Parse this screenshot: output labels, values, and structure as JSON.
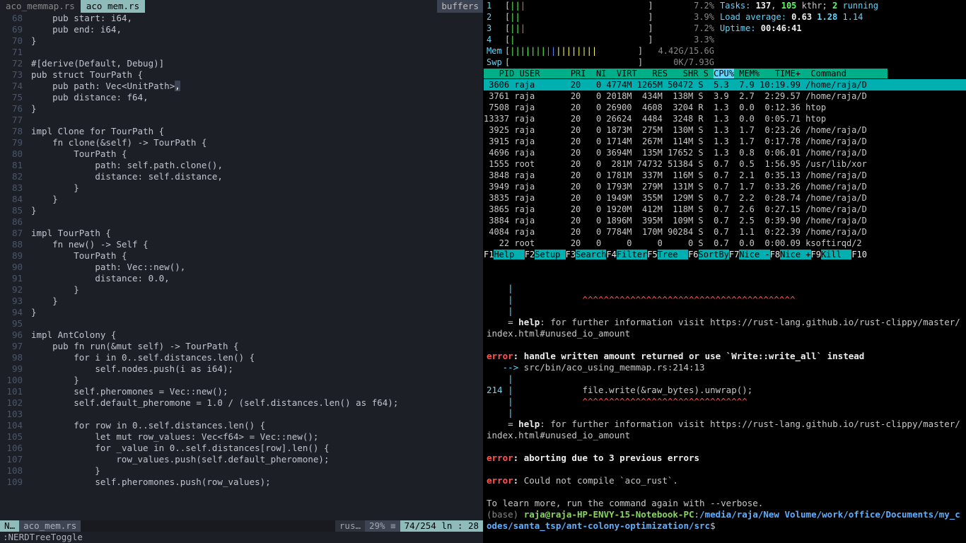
{
  "tabs": {
    "inactive": "aco_memmap.rs",
    "active": " aco mem.rs ",
    "buffers": "buffers"
  },
  "code": [
    {
      "n": 68,
      "h": "    <kw>pub</kw> <fld>start</fld>: <ty>i64</ty>,"
    },
    {
      "n": 69,
      "h": "    <kw>pub</kw> <fld>end</fld>: <ty>i64</ty>,"
    },
    {
      "n": 70,
      "h": "}"
    },
    {
      "n": 71,
      "h": ""
    },
    {
      "n": 72,
      "h": "<attr>#[derive(Default, Debug)]</attr>"
    },
    {
      "n": 73,
      "h": "<kw>pub struct</kw> <ty>TourPath</ty> {"
    },
    {
      "n": 74,
      "h": "    <kw>pub</kw> <fld>path</fld>: <ty>Vec</ty>&lt;<ty>UnitPath</ty>&gt;<span class='hlchar'>,</span>"
    },
    {
      "n": 75,
      "h": "    <kw>pub</kw> <fld>distance</fld>: <ty>f64</ty>,"
    },
    {
      "n": 76,
      "h": "}"
    },
    {
      "n": 77,
      "h": ""
    },
    {
      "n": 78,
      "h": "<kw>impl</kw> <ty>Clone</ty> <kw>for</kw> <ty>TourPath</ty> {"
    },
    {
      "n": 79,
      "h": "    <kw>fn</kw> <fnname>clone</fnname>(&amp;<sl>self</sl>) -&gt; <ty>TourPath</ty> {"
    },
    {
      "n": 80,
      "h": "        <ty>TourPath</ty> {"
    },
    {
      "n": 81,
      "h": "            <fld>path</fld>: <sl>self</sl>.path.<fnname>clone</fnname>(),"
    },
    {
      "n": 82,
      "h": "            <fld>distance</fld>: <sl>self</sl>.distance,"
    },
    {
      "n": 83,
      "h": "        }"
    },
    {
      "n": 84,
      "h": "    }"
    },
    {
      "n": 85,
      "h": "}"
    },
    {
      "n": 86,
      "h": ""
    },
    {
      "n": 87,
      "h": "<kw>impl</kw> <ty>TourPath</ty> {"
    },
    {
      "n": 88,
      "h": "    <kw>fn</kw> <fnname>new</fnname>() -&gt; <ty>Self</ty> {"
    },
    {
      "n": 89,
      "h": "        <ty>TourPath</ty> {"
    },
    {
      "n": 90,
      "h": "            <fld>path</fld>: <ty>Vec</ty>::<fnname>new</fnname>(),"
    },
    {
      "n": 91,
      "h": "            <fld>distance</fld>: <num>0.0</num>,"
    },
    {
      "n": 92,
      "h": "        }"
    },
    {
      "n": 93,
      "h": "    }"
    },
    {
      "n": 94,
      "h": "}"
    },
    {
      "n": 95,
      "h": ""
    },
    {
      "n": 96,
      "h": "<kw>impl</kw> <ty>AntColony</ty> {"
    },
    {
      "n": 97,
      "h": "    <kw>pub fn</kw> <fnname>run</fnname>(&amp;<kw>mut</kw> <sl>self</sl>) -&gt; <ty>TourPath</ty> {"
    },
    {
      "n": 98,
      "h": "        <kw>for</kw> i <kw>in</kw> <num>0</num>..<sl>self</sl>.distances.<fnname>len</fnname>() {"
    },
    {
      "n": 99,
      "h": "            <sl>self</sl>.nodes.<fnname>push</fnname>(i <kw>as</kw> <ty>i64</ty>);"
    },
    {
      "n": 100,
      "h": "        }"
    },
    {
      "n": 101,
      "h": "        <sl>self</sl>.pheromones = <ty>Vec</ty>::<fnname>new</fnname>();"
    },
    {
      "n": 102,
      "h": "        <sl>self</sl>.default_pheromone = <num>1.0</num> / (<sl>self</sl>.distances.<fnname>len</fnname>() <kw>as</kw> <ty>f64</ty>);"
    },
    {
      "n": 103,
      "h": ""
    },
    {
      "n": 104,
      "h": "        <kw>for</kw> row <kw>in</kw> <num>0</num>..<sl>self</sl>.distances.<fnname>len</fnname>() {"
    },
    {
      "n": 105,
      "h": "            <kw>let mut</kw> row_values: <ty>Vec</ty>&lt;<ty>f64</ty>&gt; = <ty>Vec</ty>::<fnname>new</fnname>();"
    },
    {
      "n": 106,
      "h": "            <kw>for</kw> _value <kw>in</kw> <num>0</num>..<sl>self</sl>.distances[row].<fnname>len</fnname>() {"
    },
    {
      "n": 107,
      "h": "                row_values.<fnname>push</fnname>(<sl>self</sl>.default_pheromone);"
    },
    {
      "n": 108,
      "h": "            }"
    },
    {
      "n": 109,
      "h": "            <sl>self</sl>.pheromones.<fnname>push</fnname>(row_values);"
    }
  ],
  "status": {
    "mode": "N…",
    "file": "aco_mem.rs",
    "ft": "rus…",
    "pct": "29% ≡",
    "pos": "74/254 ln : 28"
  },
  "cmd": ":NERDTreeToggle",
  "htop": {
    "cpus": [
      {
        "n": "1",
        "bar": "[<span class='c-grn'>||</span><span class='c-red'>|</span>                        ]",
        "pct": "7.2%"
      },
      {
        "n": "2",
        "bar": "[<span class='c-grn'>||</span>                         ]",
        "pct": "3.9%"
      },
      {
        "n": "3",
        "bar": "[<span class='c-grn'>||</span><span class='c-red'>|</span>                        ]",
        "pct": "7.2%"
      },
      {
        "n": "4",
        "bar": "[<span class='c-grn'>|</span>                          ]",
        "pct": "3.3%"
      }
    ],
    "mem": {
      "label": "Mem",
      "bar": "[<span class='c-grn'>|||||||</span><span class='c-blu'>||</span><span class='c-yel'>||||||||</span>        ]",
      "val": "4.42G/15.6G"
    },
    "swp": {
      "label": "Swp",
      "bar": "[                         ]",
      "val": "0K/7.93G"
    },
    "meta": {
      "tasks": "Tasks: ",
      "tasks_n": "137",
      "tasks_sep": ", ",
      "kthr": "105",
      "kthr_l": " kthr; ",
      "run": "2",
      "run_l": " running",
      "load_l": "Load average: ",
      "l1": "0.63",
      "l2": "1.28",
      "l3": "1.14",
      "up_l": "Uptime: ",
      "up": "00:46:41"
    },
    "header": "   PID USER      PRI  NI  VIRT   RES   SHR S ",
    "sortcol": "CPU%",
    "header2": " MEM%   TIME+  Command",
    "procs": [
      " 3606 raja       20   0 4774M 1265M 50472 S  5.3  7.9 10:19.99 /home/raja/D",
      " 3761 raja       20   0 2018M  434M  138M S  3.9  2.7  2:29.57 /home/raja/D",
      " 7508 raja       20   0 26900  4608  3204 R  1.3  0.0  0:12.36 htop",
      "13337 raja       20   0 26624  4484  3248 R  1.3  0.0  0:05.71 htop",
      " 3925 raja       20   0 1873M  275M  130M S  1.3  1.7  0:23.26 /home/raja/D",
      " 3915 raja       20   0 1714M  267M  114M S  1.3  1.7  0:17.78 /home/raja/D",
      " 4696 raja       20   0 3694M  135M 17652 S  1.3  0.8  0:06.01 /home/raja/D",
      " 1555 root       20   0  281M 74732 51384 S  0.7  0.5  1:56.95 /usr/lib/xor",
      " 3848 raja       20   0 1781M  337M  116M S  0.7  2.1  0:35.13 /home/raja/D",
      " 3949 raja       20   0 1793M  279M  131M S  0.7  1.7  0:33.26 /home/raja/D",
      " 3835 raja       20   0 1949M  355M  129M S  0.7  2.2  0:28.74 /home/raja/D",
      " 3865 raja       20   0 1920M  412M  118M S  0.7  2.6  0:27.15 /home/raja/D",
      " 3884 raja       20   0 1896M  395M  109M S  0.7  2.5  0:39.90 /home/raja/D",
      " 4084 raja       20   0 7784M  170M 90284 S  0.7  1.1  0:22.39 /home/raja/D",
      "   22 root       20   0     0     0     0 S  0.7  0.0  0:00.09 ksoftirqd/2"
    ],
    "fkeys": [
      [
        "F1",
        "Help  "
      ],
      [
        "F2",
        "Setup "
      ],
      [
        "F3",
        "Search"
      ],
      [
        "F4",
        "Filter"
      ],
      [
        "F5",
        "Tree  "
      ],
      [
        "F6",
        "SortBy"
      ],
      [
        "F7",
        "Nice -"
      ],
      [
        "F8",
        "Nice +"
      ],
      [
        "F9",
        "Kill  "
      ],
      [
        "F10",
        ""
      ]
    ]
  },
  "term": {
    "lines": [
      "    <span class='t-cyn'>|</span>",
      "    <span class='t-cyn'>|</span>             <span class='t-car'>^^^^^^^^^^^^^^^^^^^^^^^^^^^^^^^^^^^^^^^^</span>",
      "    <span class='t-cyn'>|</span>",
      "    = <span class='t-wht'>help</span>: for further information visit https://rust-lang.github.io/rust-clippy/master/index.html#unused_io_amount",
      "",
      "<span class='t-red'>error</span><span class='t-wht'>: handle written amount returned or use `Write::write_all` instead</span>",
      "   <span class='t-cyn'>--&gt;</span> src/bin/aco_using_memmap.rs:214:13",
      "    <span class='t-cyn'>|</span>",
      "<span class='t-cyn'>214</span> <span class='t-cyn'>|</span>             file.write(&amp;raw_bytes).unwrap();",
      "    <span class='t-cyn'>|</span>             <span class='t-car'>^^^^^^^^^^^^^^^^^^^^^^^^^^^^^^^</span>",
      "    <span class='t-cyn'>|</span>",
      "    = <span class='t-wht'>help</span>: for further information visit https://rust-lang.github.io/rust-clippy/master/index.html#unused_io_amount",
      "",
      "<span class='t-red'>error</span><span class='t-wht'>: aborting due to 3 previous errors</span>",
      "",
      "<span class='t-red'>error</span><span class='t-wht'>:</span> Could not compile `aco_rust`.",
      "",
      "To learn more, run the command again with --verbose.",
      "<span class='t-base'>(base) </span><span class='t-green'>raja@raja-HP-ENVY-15-Notebook-PC</span>:<span class='t-path'>/media/raja/New Volume/work/office/Documents/my_codes/santa_tsp/ant-colony-optimization/src</span>$"
    ]
  }
}
